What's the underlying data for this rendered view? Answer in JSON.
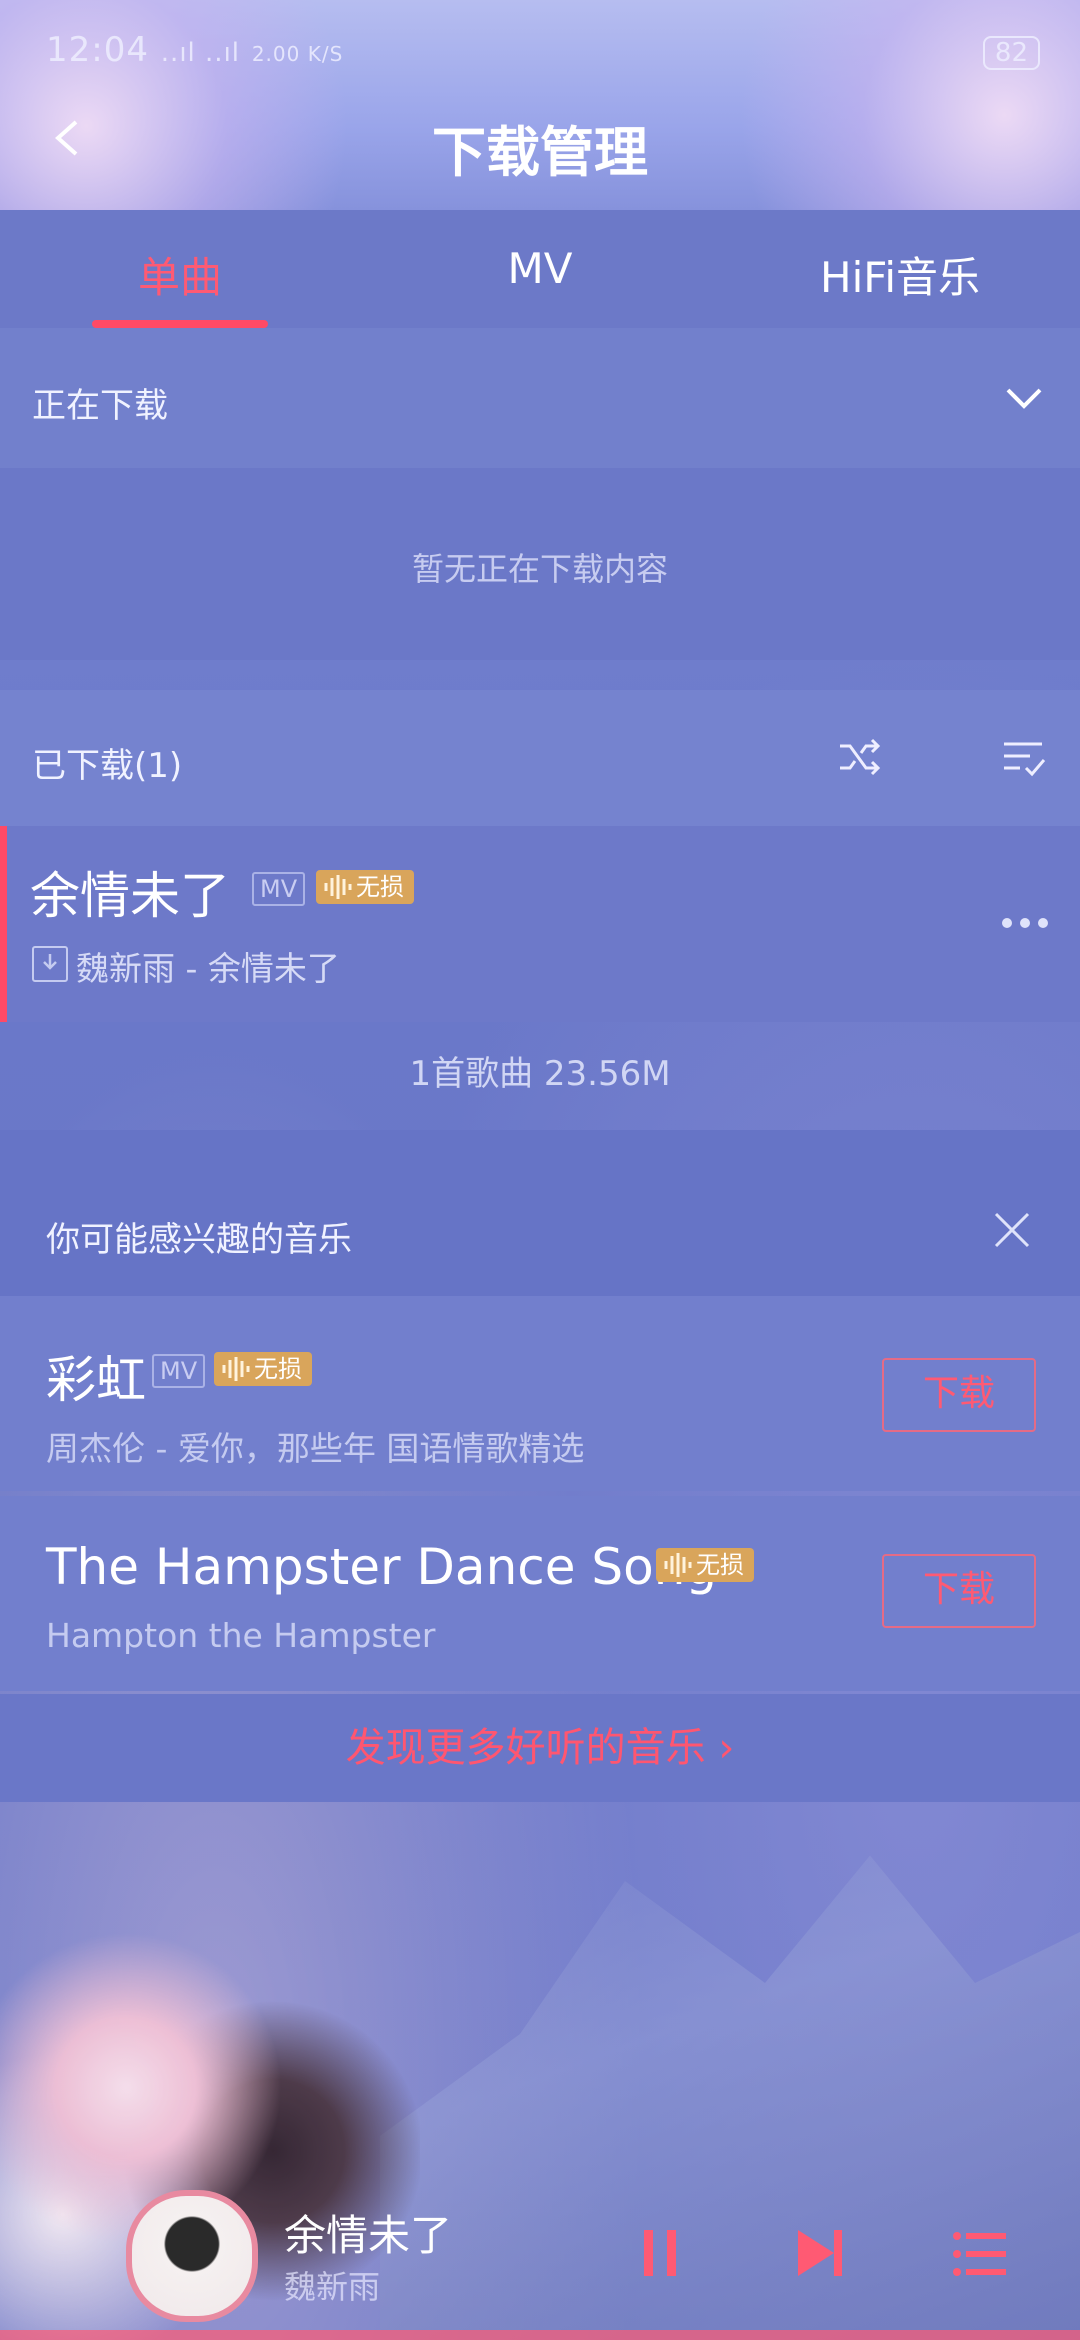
{
  "status_bar": {
    "time": "12:04",
    "signal": "..ıl ..ıl",
    "net_speed": "2.00 K/S",
    "battery": "82"
  },
  "header": {
    "title": "下载管理"
  },
  "tabs": [
    {
      "label": "单曲",
      "active": true
    },
    {
      "label": "MV",
      "active": false
    },
    {
      "label": "HiFi音乐",
      "active": false
    }
  ],
  "downloading": {
    "label": "正在下载",
    "empty_text": "暂无正在下载内容"
  },
  "downloaded": {
    "label": "已下载(1)",
    "items": [
      {
        "title": "余情未了",
        "mv_tag": "MV",
        "quality_tag": "无损",
        "subtitle": "魏新雨 - 余情未了"
      }
    ],
    "summary": "1首歌曲 23.56M"
  },
  "recommend": {
    "title": "你可能感兴趣的音乐",
    "items": [
      {
        "title": "彩虹",
        "mv_tag": "MV",
        "quality_tag": "无损",
        "subtitle": "周杰伦 - 爱你，那些年 国语情歌精选",
        "button": "下载"
      },
      {
        "title": "The Hampster Dance Song",
        "quality_tag": "无损",
        "subtitle": "Hampton the Hampster",
        "button": "下载"
      }
    ],
    "discover_more": "发现更多好听的音乐"
  },
  "player": {
    "title": "余情未了",
    "artist": "魏新雨"
  },
  "colors": {
    "accent": "#ff4a66",
    "quality": "#d9a55b",
    "background": "#6a78c9"
  }
}
